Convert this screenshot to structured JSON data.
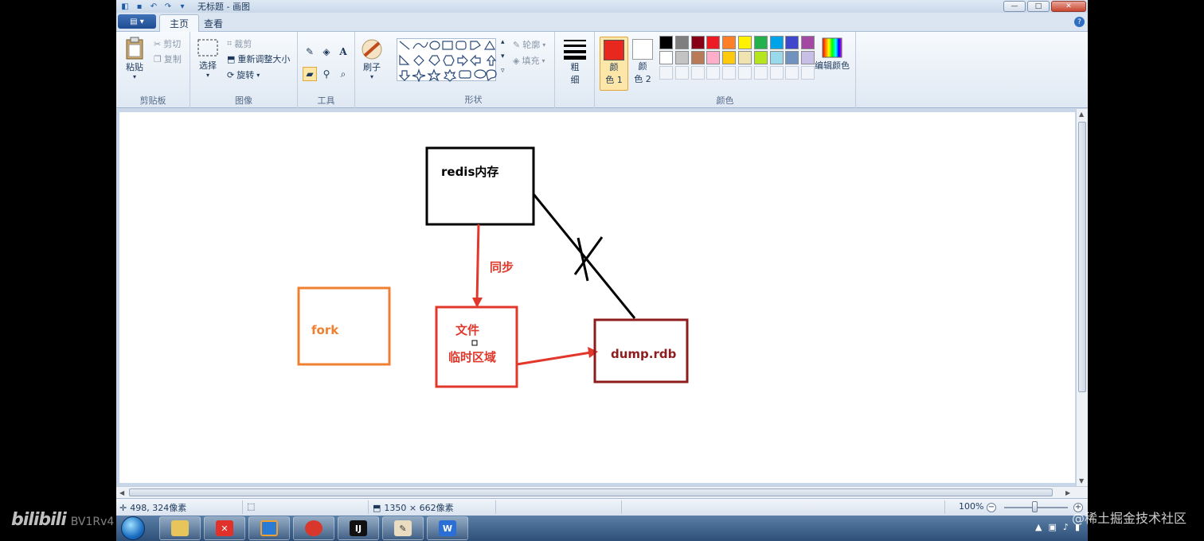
{
  "window": {
    "title": "无标题 - 画图",
    "buttons": {
      "minimize": "—",
      "maximize": "□",
      "close": "✕"
    }
  },
  "tabs": {
    "file": "▤ ▾",
    "home": "主页",
    "view": "查看",
    "help": "?"
  },
  "ribbon": {
    "clipboard": {
      "paste": "粘贴",
      "cut": "剪切",
      "copy": "复制",
      "label": "剪贴板"
    },
    "image": {
      "select": "选择",
      "crop": "裁剪",
      "resize": "重新调整大小",
      "rotate": "旋转",
      "label": "图像"
    },
    "tools": {
      "label": "工具",
      "text_glyph": "A"
    },
    "brushes": {
      "label": "刷子"
    },
    "shapes": {
      "outline": "轮廓",
      "fill": "填充",
      "label": "形状"
    },
    "size": {
      "line1": "粗",
      "line2": "细"
    },
    "colors": {
      "color1_line1": "颜",
      "color1_line2": "色 1",
      "color2_line1": "颜",
      "color2_line2": "色 2",
      "edit": "编辑颜色",
      "label": "颜色",
      "color1": "#e8271f",
      "color2": "#ffffff",
      "row1": [
        "#000000",
        "#7f7f7f",
        "#880015",
        "#ed1c24",
        "#ff7f27",
        "#fff200",
        "#22b14c",
        "#00a2e8",
        "#3f48cc",
        "#a349a4"
      ],
      "row2": [
        "#ffffff",
        "#c3c3c3",
        "#b97a57",
        "#ffaec9",
        "#ffc90e",
        "#efe4b0",
        "#b5e61d",
        "#99d9ea",
        "#7092be",
        "#c8bfe7"
      ]
    }
  },
  "drawing": {
    "redis_box": "redis内存",
    "sync_label": "同步",
    "fork_box": "fork",
    "temp_line1": "文件",
    "temp_line2": "临时区域",
    "dump_box": "dump.rdb",
    "colors": {
      "black": "#000000",
      "red": "#e2372b",
      "orange": "#f08030",
      "darkred": "#8e1c1c"
    }
  },
  "status": {
    "cursor_pos": "498, 324像素",
    "canvas_size": "1350 × 662像素",
    "zoom": "100%"
  },
  "taskbar": {
    "apps": [
      "explorer-icon",
      "xmind-icon",
      "virtualbox-icon",
      "redis-icon",
      "intellij-icon",
      "paint-icon",
      "wps-icon"
    ],
    "wps_glyph": "W",
    "ij_glyph": "IJ",
    "x_glyph": "✕"
  },
  "overlay": {
    "bilibili": "bilibili",
    "bv": "BV1Rv4",
    "juejin": "@稀土掘金技术社区"
  }
}
